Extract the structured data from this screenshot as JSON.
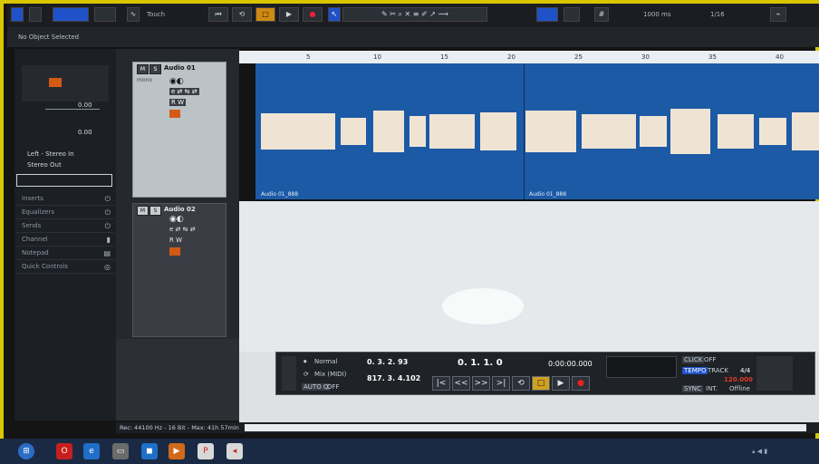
{
  "toolbar": {
    "touch_label": "Touch",
    "time_display": "1000 ms",
    "quantize": "1/16"
  },
  "info_line": "No Object Selected",
  "inspector": {
    "routing_in": "Left - Stereo In",
    "routing_out": "Stereo Out",
    "volume_value": "0.00",
    "pan_value": "0.00",
    "sections": [
      "Inserts",
      "Equalizers",
      "Sends",
      "Channel",
      "Notepad",
      "Quick Controls"
    ]
  },
  "tracks": [
    {
      "name": "Audio 01",
      "mode": "mono",
      "clip_labels": [
        "Audio 01_888",
        "Audio 01_888"
      ]
    },
    {
      "name": "Audio 02"
    }
  ],
  "ruler": {
    "ticks": [
      "5",
      "10",
      "15",
      "20",
      "25",
      "30",
      "35",
      "40"
    ]
  },
  "transport": {
    "mode1": "Normal",
    "mode2": "Mix (MIDI)",
    "auto_q": "AUTO Q",
    "auto_q_state": "OFF",
    "left_locator": "0. 3. 2. 93",
    "right_locator": "817. 3. 4.102",
    "position_bars": "0. 1. 1.   0",
    "position_time": "0:00:00.000",
    "click_label": "CLICK",
    "click_state": "OFF",
    "tempo_label": "TEMPO",
    "track_label": "TRACK",
    "signature": "4/4",
    "tempo_value": "120.000",
    "sync_label": "SYNC",
    "sync_mode": "INT.",
    "sync_state": "Offline"
  },
  "status": "Rec: 44100 Hz - 16 Bit - Max: 41h 57min"
}
